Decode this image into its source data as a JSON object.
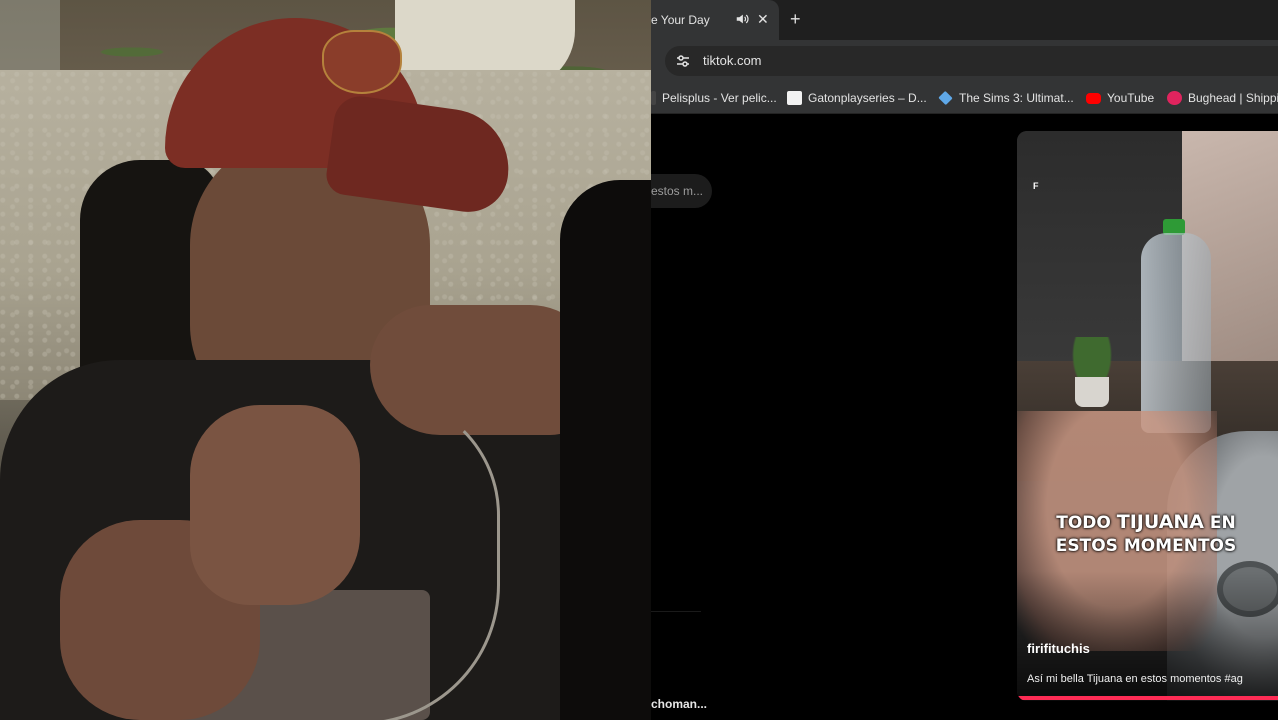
{
  "browser": {
    "tab": {
      "title": "e Your Day",
      "audio_icon": "speaker-icon",
      "close_icon": "close-icon"
    },
    "new_tab_icon": "plus-icon",
    "address_bar": {
      "url": "tiktok.com",
      "site_info_icon": "tune-icon"
    },
    "bookmarks": [
      {
        "label": "Pelisplus - Ver pelic...",
        "icon": "pelisplus-icon",
        "color": "#444444"
      },
      {
        "label": "Gatonplayseries – D...",
        "icon": "cat-icon",
        "color": "#f2f2f2"
      },
      {
        "label": "The Sims 3: Ultimat...",
        "icon": "diamond-icon",
        "color": "#5fa8e8"
      },
      {
        "label": "YouTube",
        "icon": "youtube-icon",
        "color": "#ff0000"
      },
      {
        "label": "Bughead | Shippin",
        "icon": "fandom-icon",
        "color": "#e0245e"
      }
    ]
  },
  "tiktok": {
    "search_chip": "estos m...",
    "bottom_user": "choman...",
    "video": {
      "logo": "F",
      "caption_prefix": "TODO ",
      "caption_highlight": "TIJUANA",
      "caption_suffix": " EN",
      "caption_line2": "ESTOS MOMENTOS",
      "author": "firifituchis",
      "description": "Así mi bella Tijuana en estos momentos #ag",
      "progress_color": "#fe2c55"
    }
  }
}
